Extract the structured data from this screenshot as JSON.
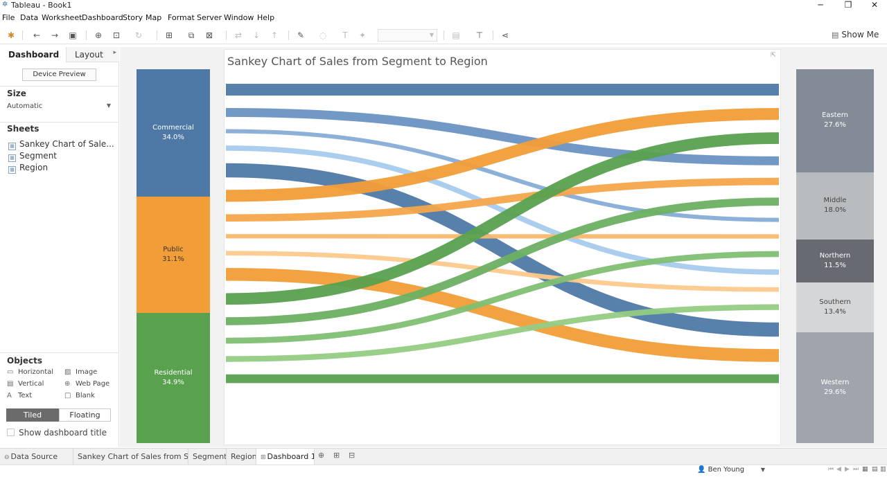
{
  "window": {
    "app_icon": "tableau-icon",
    "title": "Tableau - Book1",
    "minimize": "─",
    "maximize": "❐",
    "close": "✕"
  },
  "menu": [
    "File",
    "Data",
    "Worksheet",
    "Dashboard",
    "Story",
    "Map",
    "Format",
    "Server",
    "Window",
    "Help"
  ],
  "toolbar": {
    "icons": [
      "tableau-logo-icon",
      "undo-icon",
      "redo-icon",
      "save-icon",
      "new-datasource-icon",
      "pause-updates-icon",
      "refresh-icon",
      "new-worksheet-icon",
      "duplicate-icon",
      "clear-sheet-icon",
      "swap-icon",
      "sort-asc-icon",
      "sort-desc-icon",
      "highlight-icon",
      "group-icon",
      "label-icon",
      "pin-icon",
      "fit-icon",
      "presentation-icon",
      "share-icon"
    ],
    "show_me": "Show Me"
  },
  "left_panel": {
    "tab_dashboard": "Dashboard",
    "tab_layout": "Layout",
    "device_preview": "Device Preview",
    "size_title": "Size",
    "size_value": "Automatic",
    "sheets_title": "Sheets",
    "sheets": [
      "Sankey Chart of Sale...",
      "Segment",
      "Region"
    ],
    "objects_title": "Objects",
    "objects": {
      "horizontal": "Horizontal",
      "image": "Image",
      "vertical": "Vertical",
      "web_page": "Web Page",
      "text": "Text",
      "blank": "Blank"
    },
    "tiled": "Tiled",
    "floating": "Floating",
    "show_title": "Show dashboard title"
  },
  "segments": [
    {
      "name": "Commercial",
      "pct": "34.0%",
      "color": "#4e79a7"
    },
    {
      "name": "Public",
      "pct": "31.1%",
      "color": "#f29d38"
    },
    {
      "name": "Residential",
      "pct": "34.9%",
      "color": "#59a14f"
    }
  ],
  "regions": [
    {
      "name": "Eastern",
      "pct": "27.6%",
      "color": "#838c96"
    },
    {
      "name": "Middle",
      "pct": "18.0%",
      "color": "#b8bcbf"
    },
    {
      "name": "Northern",
      "pct": "11.5%",
      "color": "#676a70"
    },
    {
      "name": "Southern",
      "pct": "13.4%",
      "color": "#d5d6d7"
    },
    {
      "name": "Western",
      "pct": "29.6%",
      "color": "#a0a5ad"
    }
  ],
  "chart": {
    "title": "Sankey Chart of Sales from Segment to Region",
    "flow_colors": {
      "commercial": [
        "#4e79a7",
        "#6a93c2",
        "#87acd6",
        "#a6cbee"
      ],
      "public": [
        "#f29d38",
        "#f6a54b",
        "#f8b96e",
        "#fcc98c"
      ],
      "residential": [
        "#59a14f",
        "#6bb062",
        "#7fbf72",
        "#93cc83"
      ]
    }
  },
  "chart_data": {
    "type": "sankey",
    "title": "Sankey Chart of Sales from Segment to Region",
    "sources": [
      {
        "name": "Commercial",
        "share": 34.0
      },
      {
        "name": "Public",
        "share": 31.1
      },
      {
        "name": "Residential",
        "share": 34.9
      }
    ],
    "targets": [
      {
        "name": "Eastern",
        "share": 27.6
      },
      {
        "name": "Middle",
        "share": 18.0
      },
      {
        "name": "Northern",
        "share": 11.5
      },
      {
        "name": "Southern",
        "share": 13.4
      },
      {
        "name": "Western",
        "share": 29.6
      }
    ],
    "links": [
      {
        "source": "Commercial",
        "target": "Eastern",
        "value": 6.7
      },
      {
        "source": "Commercial",
        "target": "Middle",
        "value": 5.1
      },
      {
        "source": "Commercial",
        "target": "Northern",
        "value": 2.1
      },
      {
        "source": "Commercial",
        "target": "Southern",
        "value": 3.0
      },
      {
        "source": "Commercial",
        "target": "Western",
        "value": 8.1
      },
      {
        "source": "Public",
        "target": "Eastern",
        "value": 6.8
      },
      {
        "source": "Public",
        "target": "Middle",
        "value": 4.2
      },
      {
        "source": "Public",
        "target": "Northern",
        "value": 2.5
      },
      {
        "source": "Public",
        "target": "Southern",
        "value": 2.6
      },
      {
        "source": "Public",
        "target": "Western",
        "value": 7.3
      },
      {
        "source": "Residential",
        "target": "Eastern",
        "value": 6.6
      },
      {
        "source": "Residential",
        "target": "Middle",
        "value": 4.6
      },
      {
        "source": "Residential",
        "target": "Northern",
        "value": 3.4
      },
      {
        "source": "Residential",
        "target": "Southern",
        "value": 3.3
      },
      {
        "source": "Residential",
        "target": "Western",
        "value": 5.0
      }
    ]
  },
  "bottom_tabs": {
    "data_source": "Data Source",
    "sankey": "Sankey Chart of Sales from Seg...",
    "segment": "Segment",
    "region": "Region",
    "dashboard1": "Dashboard 1"
  },
  "status": {
    "user": "Ben Young"
  }
}
